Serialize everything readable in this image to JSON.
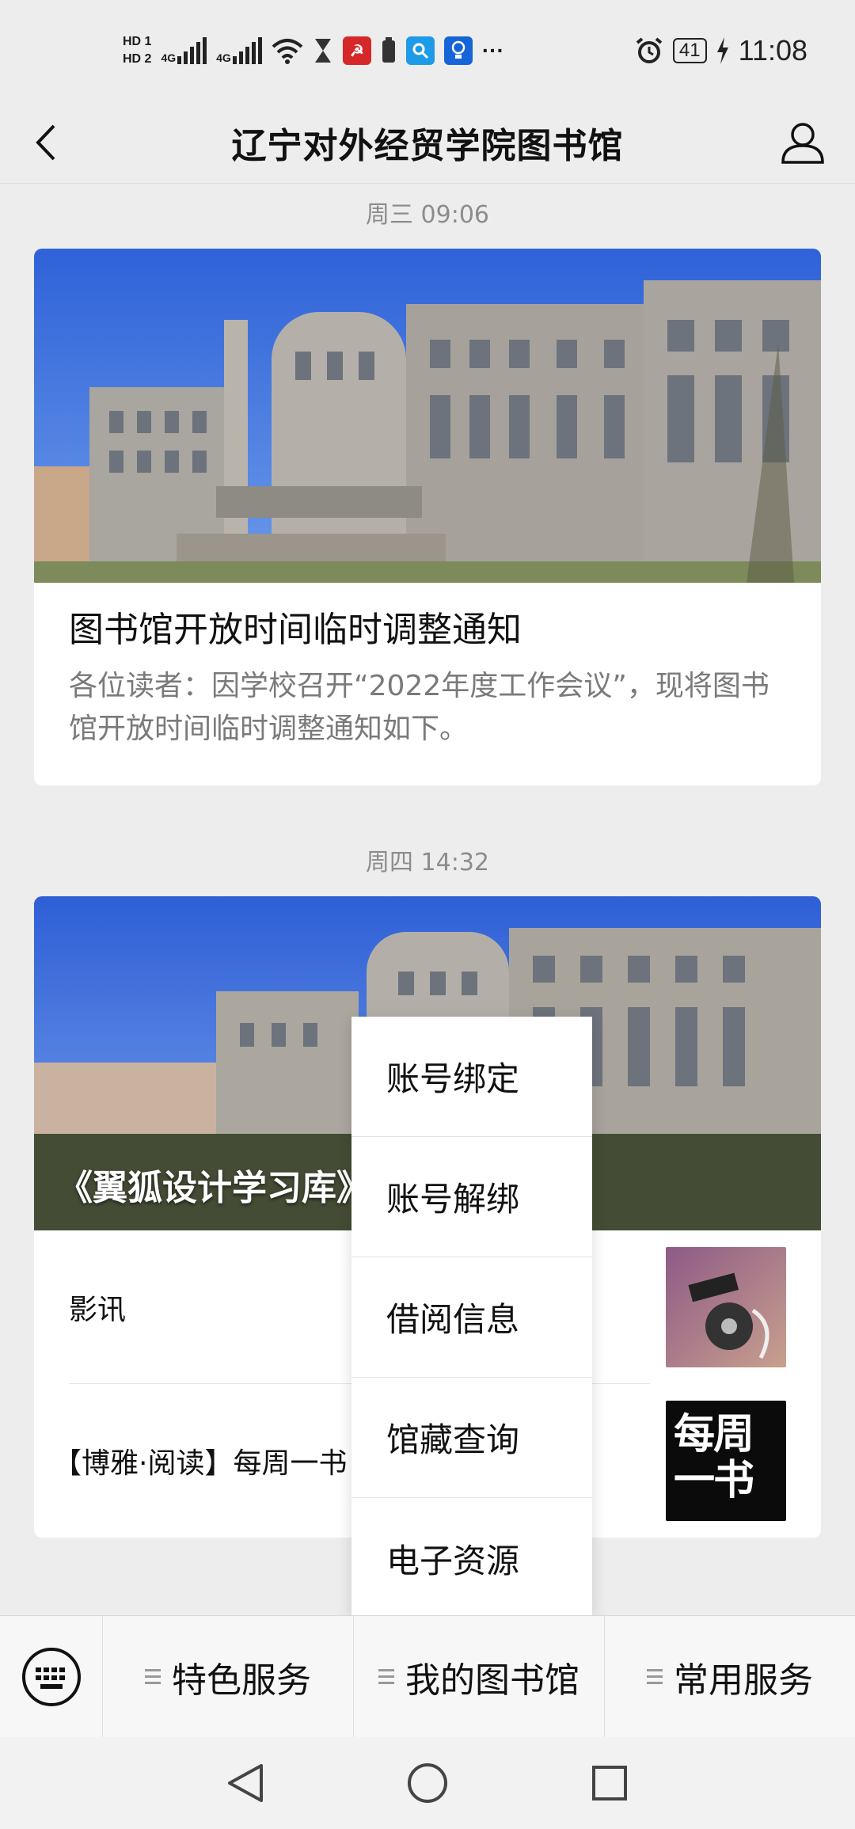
{
  "status_bar": {
    "hd1": "HD 1",
    "hd2": "HD 2",
    "net1": "4G",
    "net2": "4G",
    "battery": "41",
    "time": "11:08",
    "more": "···"
  },
  "header": {
    "title": "辽宁对外经贸学院图书馆",
    "back_icon": "chevron-left-icon",
    "profile_icon": "person-icon"
  },
  "feed": [
    {
      "time": "周三 09:06",
      "title": "图书馆开放时间临时调整通知",
      "desc": "各位读者：因学校召开“2022年度工作会议”，现将图书馆开放时间临时调整通知如下。"
    },
    {
      "time": "周四 14:32",
      "hero_caption": "《翼狐设计学习库》",
      "items": [
        {
          "label": "影讯"
        },
        {
          "label": "【博雅·阅读】每周一书《…子》",
          "thumb_text": "每周一书"
        }
      ]
    }
  ],
  "popup_menu": {
    "items": [
      "账号绑定",
      "账号解绑",
      "借阅信息",
      "馆藏查询",
      "电子资源"
    ]
  },
  "bottom_menu": {
    "keyboard_icon": "keyboard-icon",
    "tabs": [
      "特色服务",
      "我的图书馆",
      "常用服务"
    ]
  },
  "colors": {
    "background": "#ededed",
    "card": "#ffffff",
    "text_secondary": "#7a7a7a"
  }
}
